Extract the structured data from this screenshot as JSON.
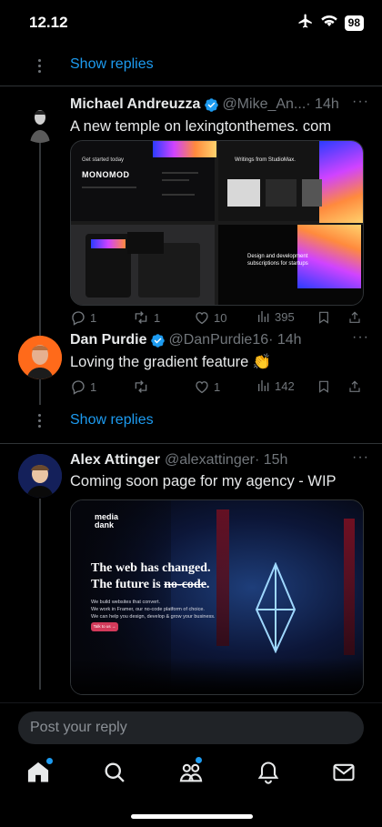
{
  "status_bar": {
    "time": "12.12",
    "battery": "98"
  },
  "thread": {
    "show_replies_label": "Show replies",
    "tweets": [
      {
        "name": "Michael Andreuzza",
        "handle": "@Mike_An...",
        "time": "· 14h",
        "text": "A new temple on lexingtonthemes. com",
        "replies": "1",
        "retweets": "1",
        "likes": "10",
        "views": "395",
        "media": {
          "cta": "Get started today",
          "brand": "MONOMOD",
          "title_right": "Writings from StudioMax.",
          "headline_1": "Design and development",
          "headline_2": "subscriptions for startups"
        }
      },
      {
        "name": "Dan Purdie",
        "handle": "@DanPurdie16",
        "time": "· 14h",
        "text": "Loving the gradient feature 👏",
        "replies": "1",
        "retweets": "",
        "likes": "1",
        "views": "142"
      },
      {
        "name": "Alex Attinger",
        "handle": "@alexattinger",
        "time": "· 15h",
        "text": "Coming soon page for my agency - WIP",
        "media": {
          "brand_1": "media",
          "brand_2": "dank",
          "heading_1": "The web has changed.",
          "heading_2a": "The future is ",
          "heading_2b": "no-code",
          "heading_2c": ".",
          "body_1": "We build websites that convert.",
          "body_2": "We work in Framer, our no-code platform of choice.",
          "body_3": "We can help you design, develop & grow your business.",
          "cta": "Talk to us →"
        }
      }
    ]
  },
  "composer": {
    "placeholder": "Post your reply"
  },
  "tabbar": [
    "home-icon",
    "search-icon",
    "communities-icon",
    "notifications-icon",
    "messages-icon"
  ],
  "colors": {
    "accent": "#1d9bf0",
    "muted": "#71767b",
    "background": "#000000"
  }
}
